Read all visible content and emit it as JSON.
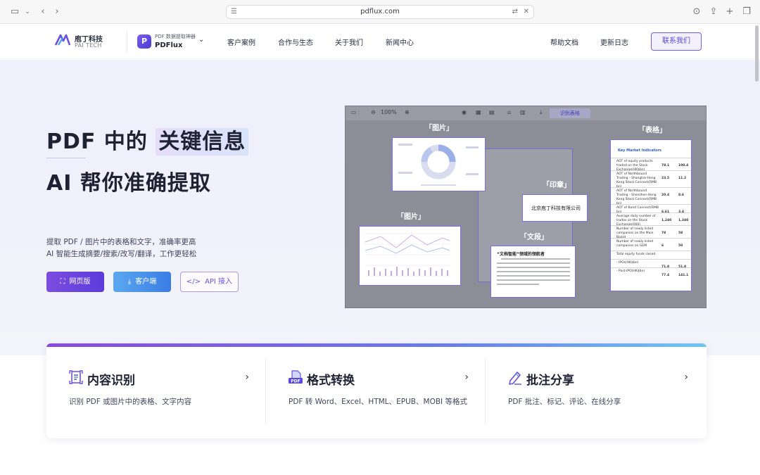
{
  "browser": {
    "url": "pdflux.com"
  },
  "nav": {
    "logo_cn": "庖丁科技",
    "logo_en": "PAI TECH",
    "product_small": "PDF 数据提取神器",
    "product_name": "PDFlux",
    "product_icon_letter": "P",
    "links": [
      "客户案例",
      "合作与生态",
      "关于我们",
      "新闻中心"
    ],
    "right_links": [
      "帮助文档",
      "更新日志"
    ],
    "contact_label": "联系我们"
  },
  "hero": {
    "title_prefix": "PDF 中的",
    "title_highlight": "关键信息",
    "title_line2": "AI 帮你准确提取",
    "subtitle1": "提取 PDF / 图片中的表格和文字，准确率更高",
    "subtitle2": "AI 智能生成摘要/搜索/改写/翻译，工作更轻松",
    "buttons": {
      "web": "网页版",
      "client": "客户端",
      "api": "API 接入"
    }
  },
  "demo": {
    "zoom": "100%",
    "identify_tab": "识别表格",
    "tags": {
      "image_top": "「图片」",
      "image_left": "「图片」",
      "table": "「表格」",
      "stamp": "「印章」",
      "paragraph": "「文段」"
    },
    "stamp_text": "北京庖丁科技有限公司",
    "paragraph_title": "“文档智能”领域的领航者",
    "table_title": "Key Market Indicators",
    "table_rows": [
      [
        "AOT of equity products traded on the Stock Exchange(HK$bn)",
        "78.1",
        "100.4"
      ],
      [
        "AOT of Northbound Trading - Shanghai-Hong Kong Stock Connect(RMB bn)",
        "23.5",
        "11.2"
      ],
      [
        "AOT of Northbound Trading - Shenzhen-Hong Kong Stock Connect(RMB bn)",
        "20.4",
        "8.6"
      ],
      [
        "AOT of Bond Connect(RMB bn)",
        "6.61",
        "3.4"
      ],
      [
        "Average daily number of trades on the Stock Exchange(000)",
        "1,240",
        "1,340"
      ],
      [
        "Number of newly listed companies on the Main Board",
        "78",
        "58"
      ],
      [
        "Number of newly listed companies on GEM",
        "6",
        "50"
      ],
      [
        "Total equity funds raised",
        "",
        ""
      ],
      [
        "- IPOs(HK$bn)",
        "71.8",
        "51.8"
      ],
      [
        "- Post-IPO(HK$bn)",
        "77.4",
        "141.1"
      ]
    ]
  },
  "features": [
    {
      "title": "内容识别",
      "icon": "scan-doc-icon",
      "desc": "识别 PDF 或图片中的表格、文字内容"
    },
    {
      "title": "格式转换",
      "icon": "pdf-convert-icon",
      "desc": "PDF 转 Word、Excel、HTML、EPUB、MOBI 等格式"
    },
    {
      "title": "批注分享",
      "icon": "pen-icon",
      "desc": "PDF 批注、标记、评论、在线分享"
    }
  ],
  "colors": {
    "brand": "#5b3bdc",
    "accent_blue": "#3a7de6"
  }
}
